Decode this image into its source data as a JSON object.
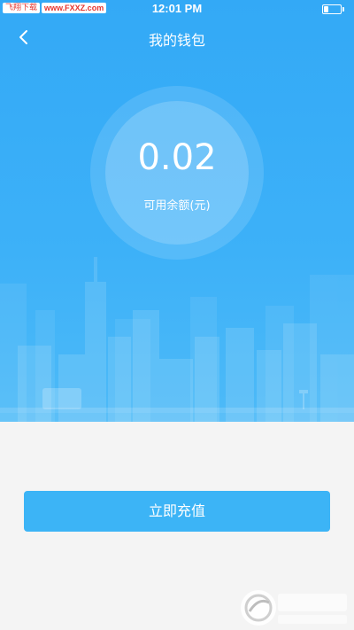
{
  "statusbar": {
    "watermark_tag": "飞翔下载",
    "watermark_site": "www.FXXZ.com",
    "time": "12:01 PM",
    "battery_level": 0.25
  },
  "nav": {
    "back_icon": "chevron-left-icon",
    "title": "我的钱包"
  },
  "wallet": {
    "balance": "0.02",
    "balance_label": "可用余额(元)"
  },
  "actions": {
    "recharge_label": "立即充值"
  },
  "watermark": {
    "brand": "飞翔下载",
    "site": "www.FXXZ.com"
  },
  "colors": {
    "primary": "#3cb4f6",
    "header_top": "#33a9f6",
    "page_bg": "#f4f4f4",
    "watermark_red": "#e5352f"
  }
}
